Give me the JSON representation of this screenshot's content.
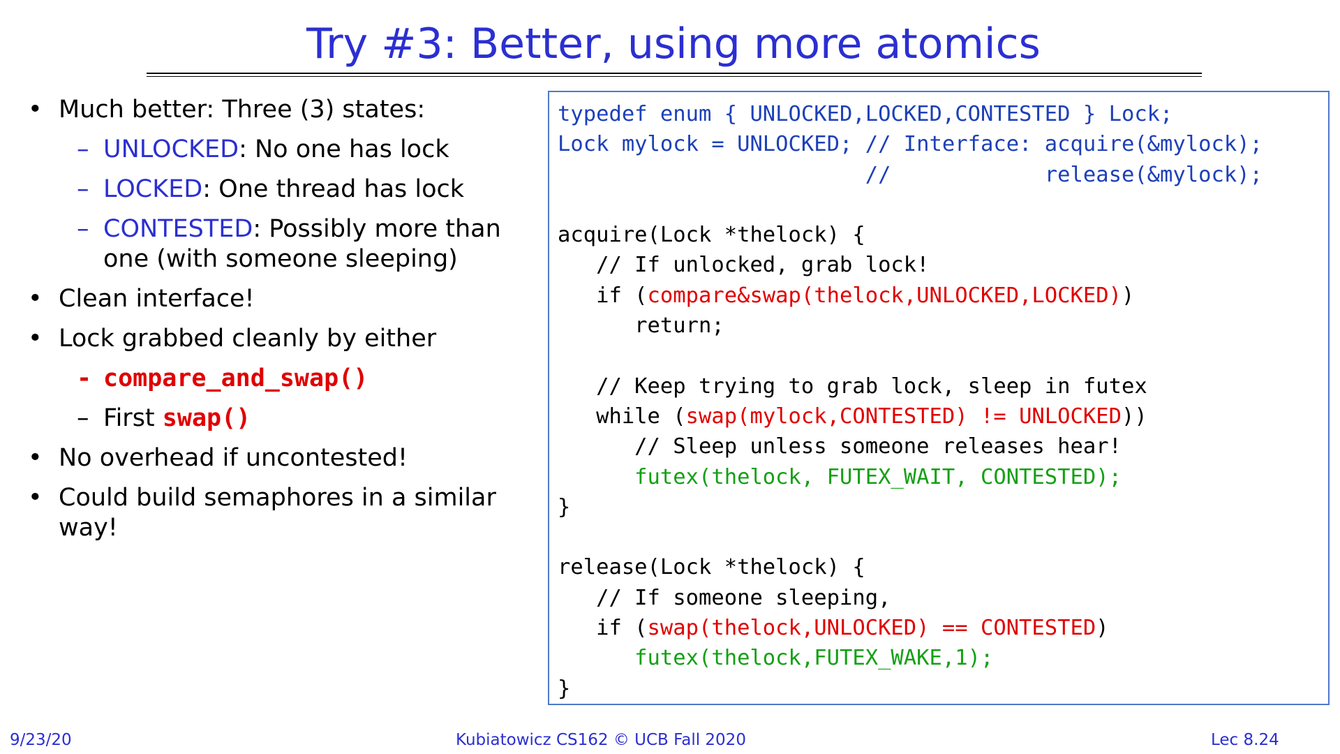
{
  "slide": {
    "title": "Try #3: Better, using more atomics"
  },
  "bullets": {
    "b1": "Much better: Three (3) states:",
    "s1_name": "UNLOCKED",
    "s1_rest": ": No one has lock",
    "s2_name": "LOCKED",
    "s2_rest": ": One thread has lock",
    "s3_name": "CONTESTED",
    "s3_rest": ": Possibly more than",
    "s3_cont": "one (with someone sleeping)",
    "b2": "Clean interface!",
    "b3": "Lock grabbed cleanly by either",
    "sub_dash_1": "–",
    "sub_dash_red": "-",
    "cas": "compare_and_swap()",
    "first_label": "First ",
    "swap": "swap()",
    "b4": "No overhead if uncontested!",
    "b5": "Could build semaphores in a similar way!"
  },
  "code": {
    "l1": "typedef enum { UNLOCKED,LOCKED,CONTESTED } Lock;",
    "l2": "Lock mylock = UNLOCKED; // Interface: acquire(&mylock);",
    "l3": "                        //            release(&mylock);",
    "l5": "acquire(Lock *thelock) {",
    "l6": "   // If unlocked, grab lock!",
    "l7_a": "   if (",
    "l7_b": "compare&swap(thelock,UNLOCKED,LOCKED)",
    "l7_c": ")",
    "l8": "      return;",
    "l10": "   // Keep trying to grab lock, sleep in futex",
    "l11_a": "   while (",
    "l11_b": "swap(mylock,CONTESTED) != UNLOCKED",
    "l11_c": "))",
    "l12": "      // Sleep unless someone releases hear!",
    "l13": "      futex(thelock, FUTEX_WAIT, CONTESTED);",
    "l14": "}",
    "l16": "release(Lock *thelock) {",
    "l17": "   // If someone sleeping,",
    "l18_a": "   if (",
    "l18_b": "swap(thelock,UNLOCKED) == CONTESTED",
    "l18_c": ")",
    "l19": "      futex(thelock,FUTEX_WAKE,1);",
    "l20": "}"
  },
  "footer": {
    "date": "9/23/20",
    "center": "Kubiatowicz CS162 © UCB Fall 2020",
    "lecture": "Lec 8.24"
  },
  "colors": {
    "title": "#2b2fd1",
    "code_blue": "#1d40b8",
    "code_red": "#e00000",
    "code_green": "#14a014",
    "box_border": "#4d79c9"
  }
}
